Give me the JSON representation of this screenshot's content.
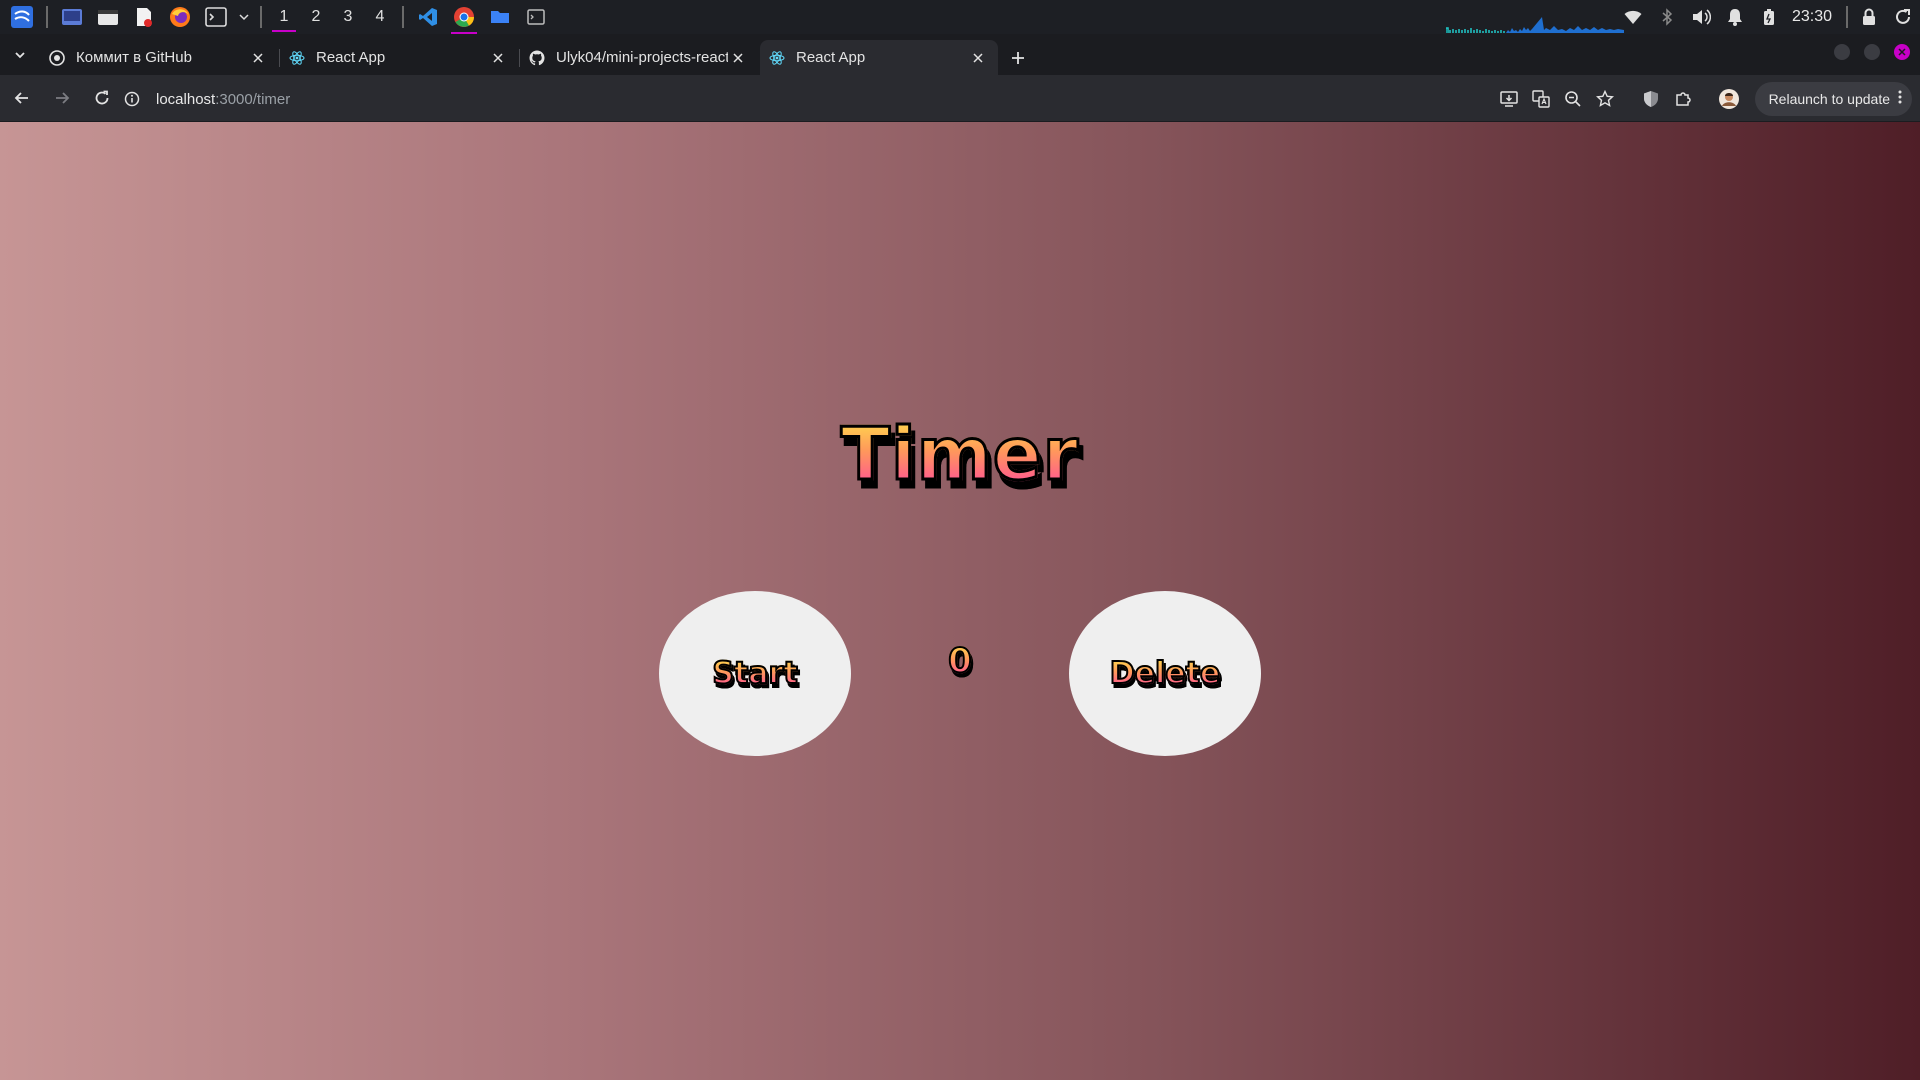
{
  "taskbar": {
    "workspaces": [
      "1",
      "2",
      "3",
      "4"
    ],
    "active_workspace": "1",
    "clock": "23:30",
    "accent_color": "#c800c8"
  },
  "browser": {
    "tabs": [
      {
        "title": "Коммит в GitHub",
        "favicon": "github-desktop-icon"
      },
      {
        "title": "React App",
        "favicon": "react-icon"
      },
      {
        "title": "Ulyk04/mini-projects-react",
        "favicon": "github-icon"
      },
      {
        "title": "React App",
        "favicon": "react-icon",
        "active": true
      }
    ],
    "url_host": "localhost",
    "url_path": ":3000/timer",
    "relaunch_label": "Relaunch to update"
  },
  "page": {
    "title": "Timer",
    "start_label": "Start",
    "counter": "0",
    "delete_label": "Delete",
    "background_colors": [
      "#c69595",
      "#4f1e27"
    ]
  }
}
